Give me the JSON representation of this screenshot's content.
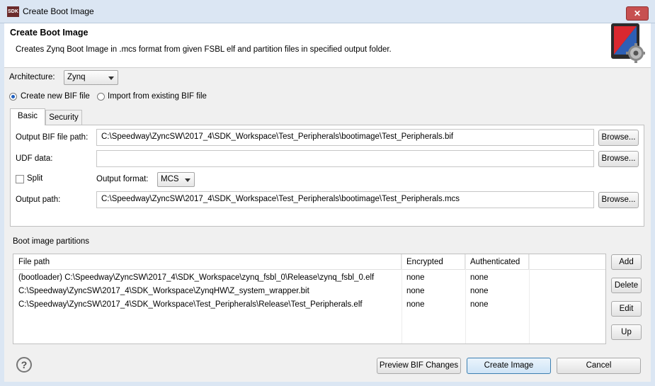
{
  "window": {
    "app_icon": "SDK",
    "title": "Create Boot Image",
    "close_glyph": "✕"
  },
  "header": {
    "title": "Create Boot Image",
    "description": "Creates Zynq Boot Image in .mcs format from given FSBL elf and partition files in specified output folder."
  },
  "architecture": {
    "label": "Architecture:",
    "value": "Zynq"
  },
  "bif_mode": {
    "create_label": "Create new BIF file",
    "import_label": "Import from existing BIF file",
    "selected": "create"
  },
  "tabs": [
    {
      "label": "Basic",
      "active": true
    },
    {
      "label": "Security",
      "active": false
    }
  ],
  "basic": {
    "output_bif_label": "Output BIF file path:",
    "output_bif_value": "C:\\Speedway\\ZyncSW\\2017_4\\SDK_Workspace\\Test_Peripherals\\bootimage\\Test_Peripherals.bif",
    "udf_label": "UDF data:",
    "udf_value": "",
    "split_label": "Split",
    "split_checked": false,
    "output_format_label": "Output format:",
    "output_format_value": "MCS",
    "output_path_label": "Output path:",
    "output_path_value": "C:\\Speedway\\ZyncSW\\2017_4\\SDK_Workspace\\Test_Peripherals\\bootimage\\Test_Peripherals.mcs",
    "browse_label": "Browse..."
  },
  "partitions": {
    "section_label": "Boot image partitions",
    "columns": [
      "File path",
      "Encrypted",
      "Authenticated"
    ],
    "rows": [
      [
        "(bootloader) C:\\Speedway\\ZyncSW\\2017_4\\SDK_Workspace\\zynq_fsbl_0\\Release\\zynq_fsbl_0.elf",
        "none",
        "none"
      ],
      [
        "C:\\Speedway\\ZyncSW\\2017_4\\SDK_Workspace\\ZynqHW\\Z_system_wrapper.bit",
        "none",
        "none"
      ],
      [
        "C:\\Speedway\\ZyncSW\\2017_4\\SDK_Workspace\\Test_Peripherals\\Release\\Test_Peripherals.elf",
        "none",
        "none"
      ]
    ],
    "buttons": {
      "add": "Add",
      "delete": "Delete",
      "edit": "Edit",
      "up": "Up"
    }
  },
  "footer": {
    "help_glyph": "?",
    "preview_label": "Preview BIF Changes",
    "create_label": "Create Image",
    "cancel_label": "Cancel"
  }
}
